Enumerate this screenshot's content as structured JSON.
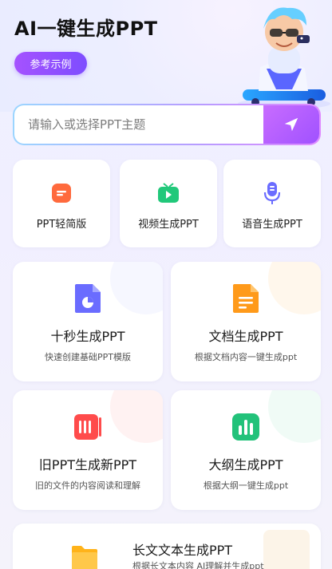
{
  "header": {
    "title": "AI一键生成PPT",
    "example_button": "参考示例"
  },
  "search": {
    "placeholder": "请输入或选择PPT主题",
    "value": "",
    "send_icon": "send-icon"
  },
  "tools": [
    {
      "label": "PPT轻简版",
      "icon": "ppt-icon",
      "color": "#ff6a3d"
    },
    {
      "label": "视频生成PPT",
      "icon": "video-icon",
      "color": "#21c87a"
    },
    {
      "label": "语音生成PPT",
      "icon": "microphone-icon",
      "color": "#6a6cff"
    }
  ],
  "cards": [
    {
      "title": "十秒生成PPT",
      "subtitle": "快速创建基础PPT模版",
      "icon": "document-chart-icon",
      "color": "#6a6cff"
    },
    {
      "title": "文档生成PPT",
      "subtitle": "根据文档内容一键生成ppt",
      "icon": "document-icon",
      "color": "#ff9a1a"
    },
    {
      "title": "旧PPT生成新PPT",
      "subtitle": "旧的文件的内容阅读和理解",
      "icon": "ppt-convert-icon",
      "color": "#ff4b4b"
    },
    {
      "title": "大纲生成PPT",
      "subtitle": "根据大纲一键生成ppt",
      "icon": "outline-chart-icon",
      "color": "#22c27a"
    }
  ],
  "long_card": {
    "title": "长文文本生成PPT",
    "subtitle": "根据长文本内容 AI理解并生成ppt",
    "icon": "folder-icon",
    "color": "#ffb31a"
  }
}
